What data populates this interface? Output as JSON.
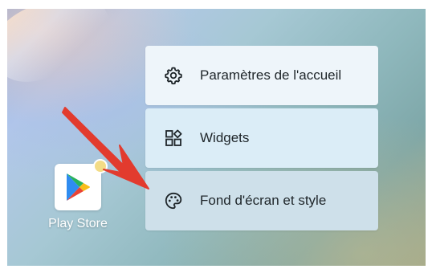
{
  "menu": {
    "items": [
      {
        "label": "Paramètres de l'accueil",
        "icon": "gear-icon"
      },
      {
        "label": "Widgets",
        "icon": "widgets-icon"
      },
      {
        "label": "Fond d'écran et style",
        "icon": "palette-icon"
      }
    ]
  },
  "app": {
    "label": "Play Store",
    "icon": "play-store-icon",
    "badge_color": "#f3dc86"
  },
  "colors": {
    "arrow": "#e23b2e"
  }
}
